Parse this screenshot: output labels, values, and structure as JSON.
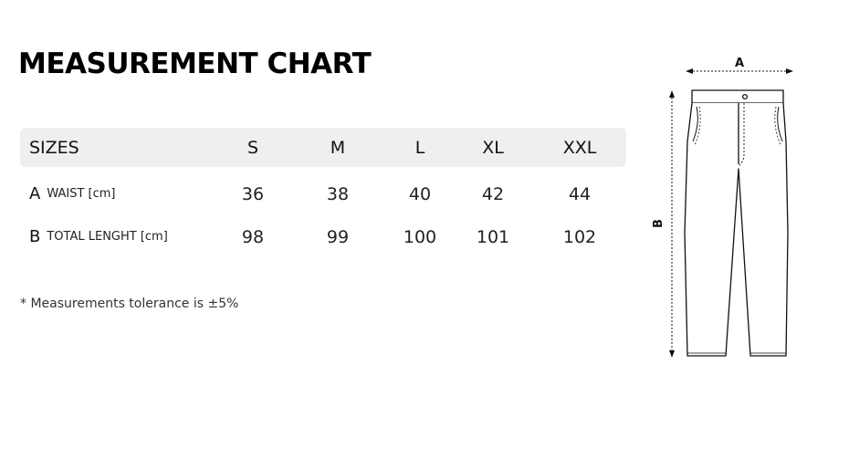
{
  "title": "MEASUREMENT CHART",
  "table": {
    "header_label": "SIZES",
    "sizes": [
      "S",
      "M",
      "L",
      "XL",
      "XXL"
    ],
    "rows": [
      {
        "letter": "A",
        "label": "WAIST [cm]",
        "values": [
          "36",
          "38",
          "40",
          "42",
          "44"
        ]
      },
      {
        "letter": "B",
        "label": "TOTAL LENGHT [cm]",
        "values": [
          "98",
          "99",
          "100",
          "101",
          "102"
        ]
      }
    ]
  },
  "note": "* Measurements tolerance is ±5%",
  "diagram": {
    "label_a": "A",
    "label_b": "B"
  }
}
